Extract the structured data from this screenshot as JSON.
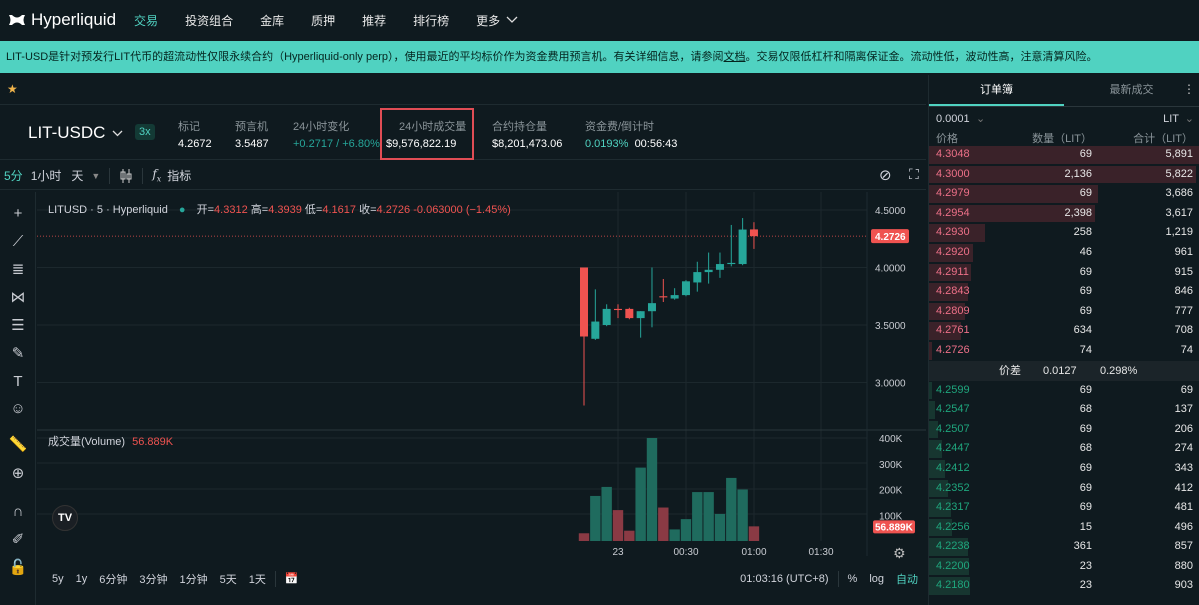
{
  "nav": {
    "brand": "Hyperliquid",
    "items": [
      "交易",
      "投资组合",
      "金库",
      "质押",
      "推荐",
      "排行榜",
      "更多"
    ],
    "active": 0
  },
  "banner": {
    "text_before": "LIT-USD是针对预发行LIT代币的超流动性仅限永续合约（Hyperliquid-only perp），使用最近的平均标价作为资金费用预言机。有关详细信息，请参阅",
    "link": "文档",
    "text_after": "。交易仅限低杠杆和隔离保证金。流动性低，波动性高，注意清算风险。"
  },
  "market": {
    "pair": "LIT-USDC",
    "leverage": "3x",
    "stats": [
      {
        "label": "标记",
        "value": "4.2672"
      },
      {
        "label": "预言机",
        "value": "3.5487"
      },
      {
        "label": "24小时变化",
        "value": "+0.2717 / +6.80%",
        "color": "green"
      },
      {
        "label": "24小时成交量",
        "value": "$9,576,822.19",
        "highlighted": true
      },
      {
        "label": "合约持仓量",
        "value": "$8,201,473.06"
      }
    ],
    "funding": {
      "label": "资金费/倒计时",
      "rate": "0.0193%",
      "countdown": "00:56:43"
    }
  },
  "toolbar": {
    "intervals": [
      "5分",
      "1小时",
      "天"
    ],
    "active_interval": "5分",
    "indicators": "指标"
  },
  "legend": {
    "symbol": "LITUSD · 5 · Hyperliquid",
    "o_label": "开=",
    "o": "4.3312",
    "h_label": "高=",
    "h": "4.3939",
    "l_label": "低=",
    "l": "4.1617",
    "c_label": "收=",
    "c": "4.2726",
    "change": "-0.063000 (−1.45%)"
  },
  "volume_legend": {
    "label": "成交量(Volume)",
    "value": "56.889K"
  },
  "chart_data": {
    "type": "candlestick",
    "interval": "5m",
    "x": [
      "23:45",
      "23:50",
      "23:55",
      "00:00",
      "00:05",
      "00:10",
      "00:15",
      "00:20",
      "00:25",
      "00:30",
      "00:35",
      "00:40",
      "00:45",
      "00:50",
      "00:55",
      "01:00"
    ],
    "open": [
      4.0,
      3.38,
      3.5,
      3.64,
      3.64,
      3.56,
      3.62,
      3.75,
      3.73,
      3.76,
      3.87,
      3.96,
      3.98,
      4.03,
      4.03,
      4.3312
    ],
    "high": [
      4.0,
      3.81,
      3.68,
      3.68,
      3.65,
      3.62,
      4.0,
      3.9,
      3.82,
      3.89,
      4.05,
      4.13,
      4.13,
      4.37,
      4.43,
      4.3939
    ],
    "low": [
      2.8,
      3.37,
      3.49,
      3.56,
      3.55,
      3.39,
      3.48,
      3.7,
      3.72,
      3.75,
      3.79,
      3.86,
      3.91,
      4.01,
      4.02,
      4.1617
    ],
    "close": [
      3.4,
      3.53,
      3.64,
      3.63,
      3.56,
      3.62,
      3.69,
      3.74,
      3.76,
      3.88,
      3.96,
      3.98,
      4.03,
      4.04,
      4.33,
      4.2726
    ],
    "volume": [
      30000,
      175000,
      210000,
      120000,
      40000,
      285000,
      400000,
      130000,
      45000,
      85000,
      190000,
      190000,
      105000,
      245000,
      200000,
      56889
    ],
    "price_ticks": [
      "4.5000",
      "4.0000",
      "3.5000",
      "3.0000"
    ],
    "ylim": [
      2.7,
      4.65
    ],
    "last_price": "4.2726",
    "volume_ticks": [
      "400K",
      "300K",
      "200K",
      "100K"
    ],
    "last_volume": "56.889K",
    "time_ticks": [
      "23",
      "00:30",
      "01:00",
      "01:30"
    ],
    "colors": {
      "up": "#26a69a",
      "down": "#ef5350",
      "vol_up": "#1f6b5e",
      "vol_down": "#8a3a44"
    }
  },
  "bottom": {
    "ranges": [
      "5y",
      "1y",
      "6分钟",
      "3分钟",
      "1分钟",
      "5天",
      "1天"
    ],
    "clock": "01:03:16 (UTC+8)",
    "pct": "%",
    "log": "log",
    "auto": "自动"
  },
  "orderbook": {
    "tabs": [
      "订单簿",
      "最新成交"
    ],
    "tick": "0.0001",
    "unit": "LIT",
    "headers": [
      "价格",
      "数量（LIT）",
      "合计（LIT）"
    ],
    "asks": [
      [
        "4.3048",
        "69",
        "5,891"
      ],
      [
        "4.3000",
        "2,136",
        "5,822"
      ],
      [
        "4.2979",
        "69",
        "3,686"
      ],
      [
        "4.2954",
        "2,398",
        "3,617"
      ],
      [
        "4.2930",
        "258",
        "1,219"
      ],
      [
        "4.2920",
        "46",
        "961"
      ],
      [
        "4.2911",
        "69",
        "915"
      ],
      [
        "4.2843",
        "69",
        "846"
      ],
      [
        "4.2809",
        "69",
        "777"
      ],
      [
        "4.2761",
        "634",
        "708"
      ],
      [
        "4.2726",
        "74",
        "74"
      ]
    ],
    "spread": {
      "label": "价差",
      "value": "0.0127",
      "pct": "0.298%"
    },
    "bids": [
      [
        "4.2599",
        "69",
        "69"
      ],
      [
        "4.2547",
        "68",
        "137"
      ],
      [
        "4.2507",
        "69",
        "206"
      ],
      [
        "4.2447",
        "68",
        "274"
      ],
      [
        "4.2412",
        "69",
        "343"
      ],
      [
        "4.2352",
        "69",
        "412"
      ],
      [
        "4.2317",
        "69",
        "481"
      ],
      [
        "4.2256",
        "15",
        "496"
      ],
      [
        "4.2238",
        "361",
        "857"
      ],
      [
        "4.2200",
        "23",
        "880"
      ],
      [
        "4.2180",
        "23",
        "903"
      ]
    ],
    "colors": {
      "ask": "#ed7088",
      "bid": "#1fa67d",
      "ask_bar": "#3a2229",
      "bid_bar": "#173630"
    }
  }
}
